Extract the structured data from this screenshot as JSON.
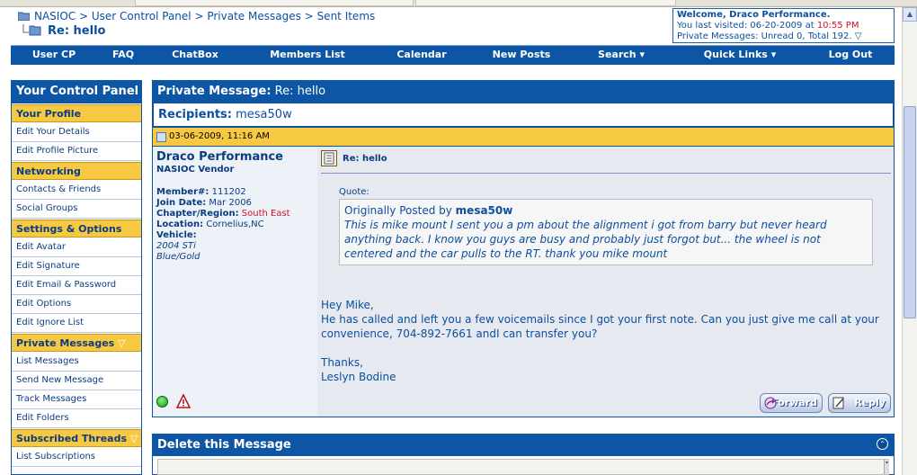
{
  "breadcrumb": {
    "items": [
      "NASIOC",
      "User Control Panel",
      "Private Messages",
      "Sent Items"
    ],
    "separator": ">",
    "page_title": "Re: hello"
  },
  "welcome": {
    "line1": "Welcome, Draco Performance.",
    "visited_prefix": "You last visited: 06-20-2009 at ",
    "visited_time": "10:55 PM",
    "pm_line": "Private Messages: Unread 0, Total 192."
  },
  "navbar": {
    "items": [
      "User CP",
      "FAQ",
      "ChatBox",
      "Members List",
      "Calendar",
      "New Posts",
      "Search",
      "Quick Links",
      "Log Out"
    ]
  },
  "sidebar": {
    "title": "Your Control Panel",
    "your_profile": "Your Profile",
    "edit_details": "Edit Your Details",
    "edit_picture": "Edit Profile Picture",
    "networking": "Networking",
    "contacts": "Contacts & Friends",
    "social": "Social Groups",
    "settings": "Settings & Options",
    "edit_avatar": "Edit Avatar",
    "edit_signature": "Edit Signature",
    "edit_email": "Edit Email & Password",
    "edit_options": "Edit Options",
    "edit_ignore": "Edit Ignore List",
    "private_messages": "Private Messages",
    "list_messages": "List Messages",
    "send_message": "Send New Message",
    "track_messages": "Track Messages",
    "edit_folders": "Edit Folders",
    "subscribed": "Subscribed Threads",
    "list_subscriptions": "List Subscriptions"
  },
  "message": {
    "header_label": "Private Message:",
    "header_title": "Re: hello",
    "recipients_label": "Recipients:",
    "recipient": "mesa50w",
    "date": "03-06-2009, 11:16 AM",
    "title": "Re: hello",
    "quote_label": "Quote:",
    "quote_prefix": "Originally Posted by ",
    "quote_author": "mesa50w",
    "quote_text": "This is mike mount I sent you a pm about the alignment i got from barry but never heard anything back. I know you guys are busy and probably just forgot but... the wheel is not centered and the car pulls to the RT. thank you mike mount",
    "body": "Hey Mike,\nHe has called and left you a few voicemails since I got your first note. Can you just give me call at your convenience, 704-892-7661 andI can transfer you?\n\nThanks,\nLeslyn Bodine",
    "forward_label": "Forward",
    "reply_label": "Reply"
  },
  "user": {
    "name": "Draco Performance",
    "title": "NASIOC Vendor",
    "member_label": "Member#:",
    "member_no": "111202",
    "join_label": "Join Date:",
    "join_date": "Mar 2006",
    "chapter_label": "Chapter/Region:",
    "chapter": "South East",
    "location_label": "Location:",
    "location": "Cornelius,NC",
    "vehicle_label": "Vehicle:",
    "vehicle_model": "2004 STi",
    "vehicle_color": "Blue/Gold"
  },
  "delete_box": {
    "title": "Delete this Message"
  },
  "colors": {
    "primary_blue": "#0d56a6",
    "header_gold": "#f7c842",
    "alert_red": "#d0102a"
  },
  "icons": [
    "folder-icon",
    "reply-arrow-icon",
    "dropdown-arrow-icon",
    "document-icon",
    "online-status-icon",
    "warning-icon",
    "message-icon",
    "forward-icon",
    "reply-icon",
    "collapse-icon"
  ]
}
